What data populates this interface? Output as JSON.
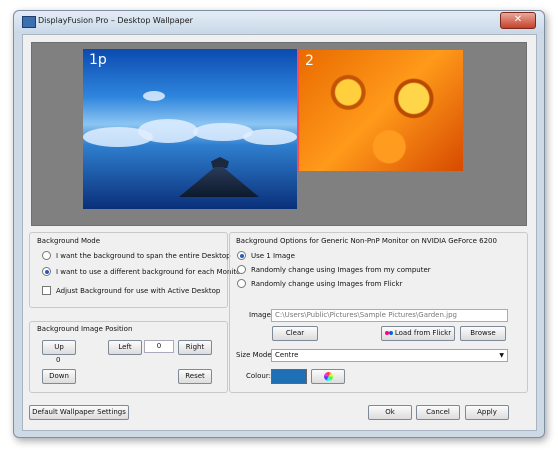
{
  "window": {
    "title": "DisplayFusion Pro – Desktop Wallpaper",
    "close_glyph": "✕"
  },
  "monitors": [
    {
      "label": "1p"
    },
    {
      "label": "2"
    }
  ],
  "background_mode": {
    "title": "Background Mode",
    "options": [
      "I want the background to span the entire Desktop",
      "I want to use a different background for each Monitor"
    ],
    "selected": 1,
    "checkbox_label": "Adjust Background for use with Active Desktop",
    "checkbox_checked": false
  },
  "image_position": {
    "title": "Background Image Position",
    "up": "Up",
    "down": "Down",
    "left": "Left",
    "right": "Right",
    "reset": "Reset",
    "vertical_value": "0",
    "horizontal_value": "0"
  },
  "options": {
    "title": "Background Options for Generic Non-PnP Monitor on NVIDIA GeForce 6200",
    "radios": [
      "Use 1 Image",
      "Randomly change using Images from my computer",
      "Randomly change using Images from Flickr"
    ],
    "selected": 0,
    "image_label": "Image:",
    "image_path": "C:\\Users\\Public\\Pictures\\Sample Pictures\\Garden.jpg",
    "clear": "Clear",
    "flickr": "Load from Flickr",
    "browse": "Browse",
    "size_mode_label": "Size Mode:",
    "size_mode_value": "Centre",
    "colour_label": "Colour:"
  },
  "colors": {
    "swatch": "#1f6fb5",
    "flickr_pink": "#ff0084",
    "flickr_blue": "#0063dc"
  },
  "footer": {
    "default_settings": "Default Wallpaper Settings",
    "ok": "Ok",
    "cancel": "Cancel",
    "apply": "Apply"
  }
}
